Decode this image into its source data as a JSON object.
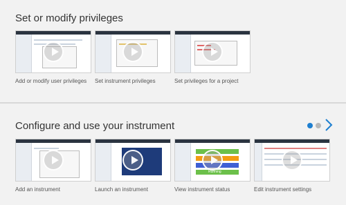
{
  "sections": [
    {
      "title": "Set or modify privileges",
      "cards": [
        {
          "label": "Add or modify user privileges"
        },
        {
          "label": "Set instrument privileges"
        },
        {
          "label": "Set privileges for a project"
        }
      ]
    },
    {
      "title": "Configure and use your instrument",
      "cards": [
        {
          "label": "Add an instrument"
        },
        {
          "label": "Launch an instrument"
        },
        {
          "label": "View instrument status"
        },
        {
          "label": "Edit instrument settings"
        }
      ],
      "pagination": {
        "current_page": 1,
        "total_pages": 2
      }
    }
  ],
  "colors": {
    "background": "#f2f2f2",
    "accent": "#1e7fd0",
    "divider": "#d8d8d8",
    "status_green": "#6cc04a",
    "status_orange": "#f39c12",
    "status_blue": "#3f5fd4"
  },
  "thumbnail_text": {
    "running": "Running"
  }
}
